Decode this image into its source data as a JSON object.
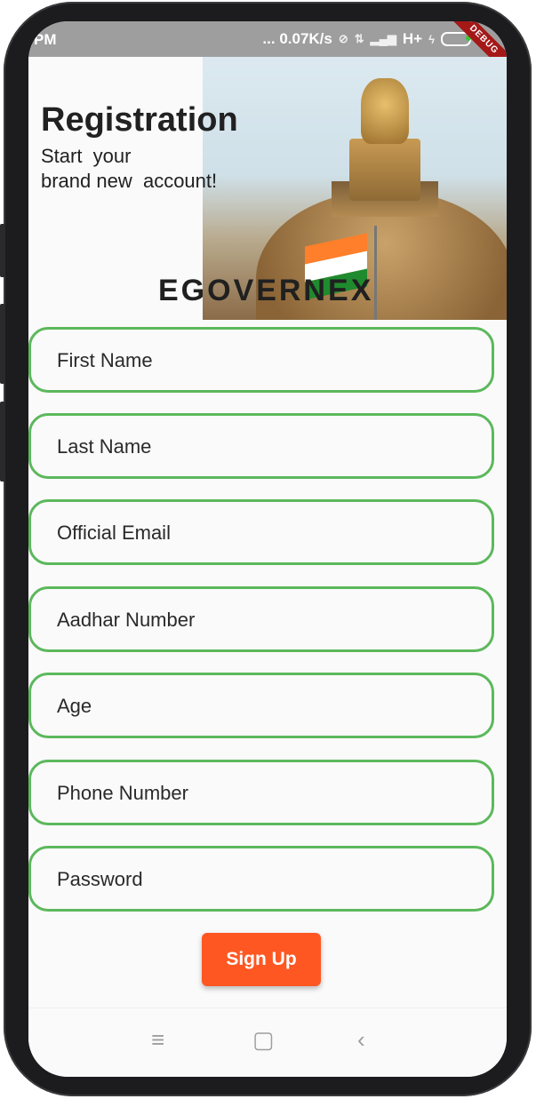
{
  "status_bar": {
    "time": "PM",
    "net_speed": "... 0.07K/s",
    "network": "H+",
    "debug_banner": "DEBUG",
    "battery_color": "#37c837"
  },
  "header": {
    "title": "Registration",
    "subtitle": "Start  your\nbrand new  account!",
    "brand": "EGOVERNEX",
    "hero_image": "india-parliament-emblem-flag-photo"
  },
  "form": {
    "fields": [
      {
        "name": "first-name",
        "placeholder": "First Name"
      },
      {
        "name": "last-name",
        "placeholder": "Last Name"
      },
      {
        "name": "official-email",
        "placeholder": "Official Email"
      },
      {
        "name": "aadhar-number",
        "placeholder": "Aadhar Number"
      },
      {
        "name": "age",
        "placeholder": "Age"
      },
      {
        "name": "phone-number",
        "placeholder": "Phone Number"
      },
      {
        "name": "password",
        "placeholder": "Password"
      }
    ],
    "submit_label": "Sign Up"
  },
  "nav_bar": {
    "menu_icon": "≡",
    "home_icon": "▢",
    "back_icon": "‹"
  },
  "colors": {
    "field_border": "#5cb85c",
    "button": "#ff5722",
    "status_bar": "#9e9e9e"
  }
}
